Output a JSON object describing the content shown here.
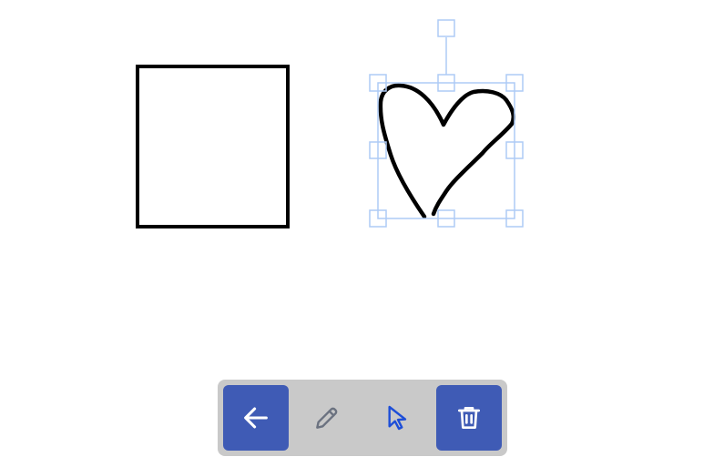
{
  "toolbar": {
    "buttons": [
      {
        "name": "back-button",
        "icon": "arrow-left-icon",
        "style": "filled",
        "color": "#ffffff"
      },
      {
        "name": "pencil-tool-button",
        "icon": "pencil-icon",
        "style": "plain",
        "color": "#6b7280"
      },
      {
        "name": "select-tool-button",
        "icon": "cursor-icon",
        "style": "plain",
        "color": "#1d4ed8"
      },
      {
        "name": "delete-button",
        "icon": "trash-icon",
        "style": "filled",
        "color": "#ffffff"
      }
    ]
  },
  "colors": {
    "toolbar_background": "#c9c9c9",
    "button_fill": "#3f5bb5",
    "selection_handles": "#aecbf5",
    "stroke": "#000000"
  },
  "canvas": {
    "shapes": [
      {
        "name": "square-shape",
        "kind": "rectangle",
        "selected": false
      },
      {
        "name": "heart-shape",
        "kind": "freehand",
        "selected": true
      }
    ]
  }
}
